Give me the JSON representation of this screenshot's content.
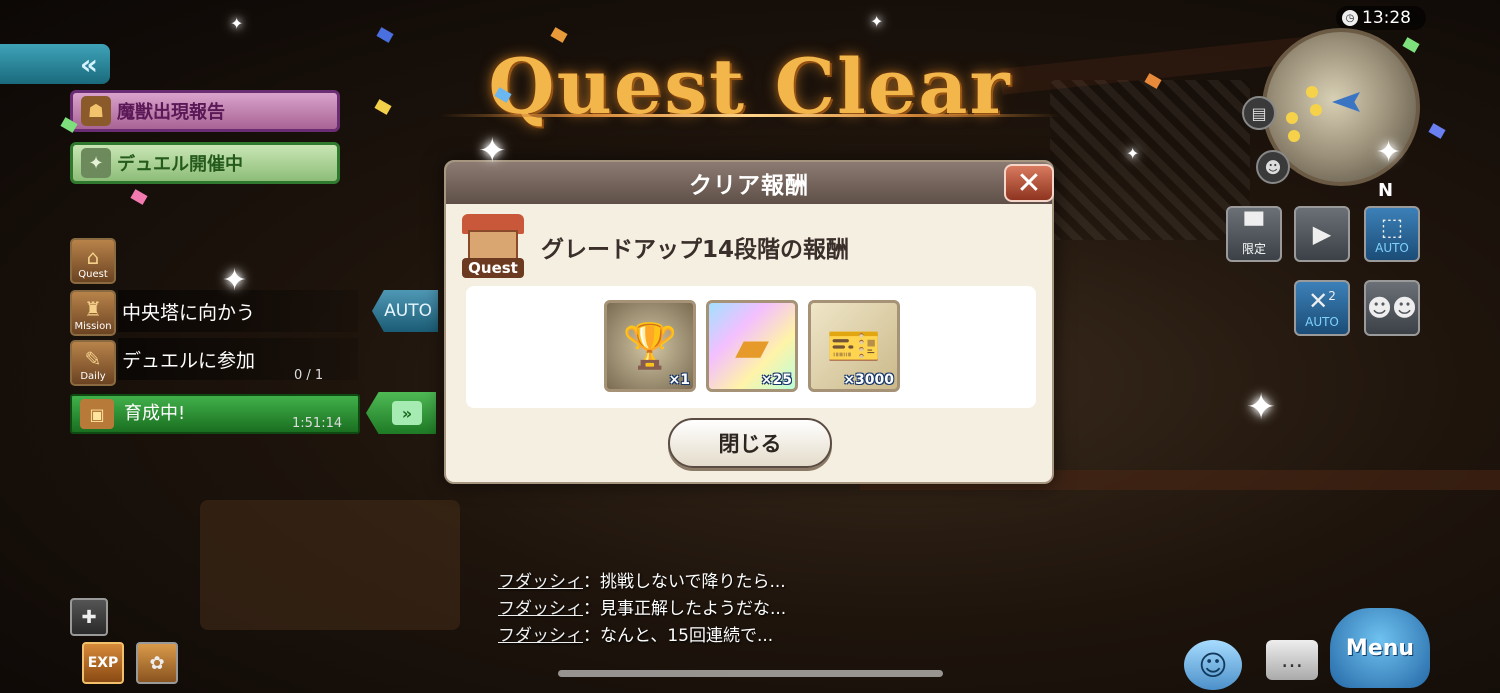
{
  "title": "Quest Clear",
  "clock": "13:28",
  "compass": "N",
  "events": [
    {
      "label": "魔獣出現報告",
      "icon": "fox-mask"
    },
    {
      "label": "デュエル開催中",
      "icon": "dragon-crest"
    }
  ],
  "quest_panel": {
    "quest_icon_label": "Quest",
    "mission_icon_label": "Mission",
    "mission_text": "中央塔に向かう",
    "auto_label": "AUTO",
    "daily_icon_label": "Daily",
    "daily_text": "デュエルに参加",
    "daily_count": "0 / 1",
    "training_text": "育成中!",
    "training_timer": "1:51:14"
  },
  "hud": {
    "limited_label": "限定",
    "auto_label": "AUTO",
    "auto2_label": "AUTO",
    "auto2_multiplier": "2"
  },
  "dialog": {
    "header": "クリア報酬",
    "quest_badge": "Quest",
    "subtitle": "グレードアップ14段階の報酬",
    "items": [
      {
        "name": "trophy-medal",
        "qty": "×1"
      },
      {
        "name": "gold-ingot",
        "qty": "×25"
      },
      {
        "name": "ticket",
        "qty": "×3000"
      }
    ],
    "close_button": "閉じる"
  },
  "chat": [
    {
      "name": "フダッシィ",
      "sep": "：",
      "text": "挑戦しないで降りたら..."
    },
    {
      "name": "フダッシィ",
      "sep": "：",
      "text": "見事正解したようだな..."
    },
    {
      "name": "フダッシィ",
      "sep": "：",
      "text": "なんと、15回連続で..."
    }
  ],
  "bottom": {
    "exp_label": "EXP",
    "menu_label": "Menu"
  }
}
